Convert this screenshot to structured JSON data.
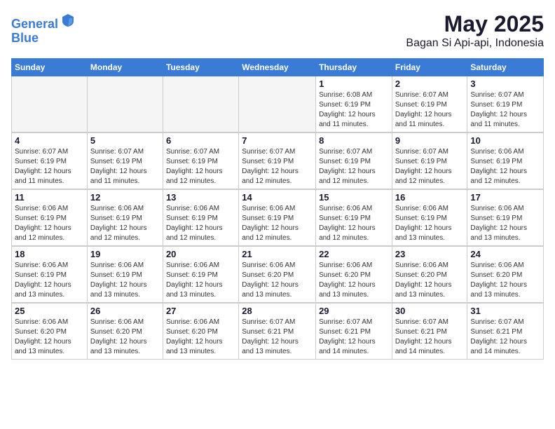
{
  "logo": {
    "line1": "General",
    "line2": "Blue"
  },
  "title": "May 2025",
  "location": "Bagan Si Api-api, Indonesia",
  "days_of_week": [
    "Sunday",
    "Monday",
    "Tuesday",
    "Wednesday",
    "Thursday",
    "Friday",
    "Saturday"
  ],
  "weeks": [
    [
      {
        "day": "",
        "info": "",
        "empty": true
      },
      {
        "day": "",
        "info": "",
        "empty": true
      },
      {
        "day": "",
        "info": "",
        "empty": true
      },
      {
        "day": "",
        "info": "",
        "empty": true
      },
      {
        "day": "1",
        "info": "Sunrise: 6:08 AM\nSunset: 6:19 PM\nDaylight: 12 hours\nand 11 minutes."
      },
      {
        "day": "2",
        "info": "Sunrise: 6:07 AM\nSunset: 6:19 PM\nDaylight: 12 hours\nand 11 minutes."
      },
      {
        "day": "3",
        "info": "Sunrise: 6:07 AM\nSunset: 6:19 PM\nDaylight: 12 hours\nand 11 minutes."
      }
    ],
    [
      {
        "day": "4",
        "info": "Sunrise: 6:07 AM\nSunset: 6:19 PM\nDaylight: 12 hours\nand 11 minutes."
      },
      {
        "day": "5",
        "info": "Sunrise: 6:07 AM\nSunset: 6:19 PM\nDaylight: 12 hours\nand 11 minutes."
      },
      {
        "day": "6",
        "info": "Sunrise: 6:07 AM\nSunset: 6:19 PM\nDaylight: 12 hours\nand 12 minutes."
      },
      {
        "day": "7",
        "info": "Sunrise: 6:07 AM\nSunset: 6:19 PM\nDaylight: 12 hours\nand 12 minutes."
      },
      {
        "day": "8",
        "info": "Sunrise: 6:07 AM\nSunset: 6:19 PM\nDaylight: 12 hours\nand 12 minutes."
      },
      {
        "day": "9",
        "info": "Sunrise: 6:07 AM\nSunset: 6:19 PM\nDaylight: 12 hours\nand 12 minutes."
      },
      {
        "day": "10",
        "info": "Sunrise: 6:06 AM\nSunset: 6:19 PM\nDaylight: 12 hours\nand 12 minutes."
      }
    ],
    [
      {
        "day": "11",
        "info": "Sunrise: 6:06 AM\nSunset: 6:19 PM\nDaylight: 12 hours\nand 12 minutes."
      },
      {
        "day": "12",
        "info": "Sunrise: 6:06 AM\nSunset: 6:19 PM\nDaylight: 12 hours\nand 12 minutes."
      },
      {
        "day": "13",
        "info": "Sunrise: 6:06 AM\nSunset: 6:19 PM\nDaylight: 12 hours\nand 12 minutes."
      },
      {
        "day": "14",
        "info": "Sunrise: 6:06 AM\nSunset: 6:19 PM\nDaylight: 12 hours\nand 12 minutes."
      },
      {
        "day": "15",
        "info": "Sunrise: 6:06 AM\nSunset: 6:19 PM\nDaylight: 12 hours\nand 12 minutes."
      },
      {
        "day": "16",
        "info": "Sunrise: 6:06 AM\nSunset: 6:19 PM\nDaylight: 12 hours\nand 13 minutes."
      },
      {
        "day": "17",
        "info": "Sunrise: 6:06 AM\nSunset: 6:19 PM\nDaylight: 12 hours\nand 13 minutes."
      }
    ],
    [
      {
        "day": "18",
        "info": "Sunrise: 6:06 AM\nSunset: 6:19 PM\nDaylight: 12 hours\nand 13 minutes."
      },
      {
        "day": "19",
        "info": "Sunrise: 6:06 AM\nSunset: 6:19 PM\nDaylight: 12 hours\nand 13 minutes."
      },
      {
        "day": "20",
        "info": "Sunrise: 6:06 AM\nSunset: 6:19 PM\nDaylight: 12 hours\nand 13 minutes."
      },
      {
        "day": "21",
        "info": "Sunrise: 6:06 AM\nSunset: 6:20 PM\nDaylight: 12 hours\nand 13 minutes."
      },
      {
        "day": "22",
        "info": "Sunrise: 6:06 AM\nSunset: 6:20 PM\nDaylight: 12 hours\nand 13 minutes."
      },
      {
        "day": "23",
        "info": "Sunrise: 6:06 AM\nSunset: 6:20 PM\nDaylight: 12 hours\nand 13 minutes."
      },
      {
        "day": "24",
        "info": "Sunrise: 6:06 AM\nSunset: 6:20 PM\nDaylight: 12 hours\nand 13 minutes."
      }
    ],
    [
      {
        "day": "25",
        "info": "Sunrise: 6:06 AM\nSunset: 6:20 PM\nDaylight: 12 hours\nand 13 minutes."
      },
      {
        "day": "26",
        "info": "Sunrise: 6:06 AM\nSunset: 6:20 PM\nDaylight: 12 hours\nand 13 minutes."
      },
      {
        "day": "27",
        "info": "Sunrise: 6:06 AM\nSunset: 6:20 PM\nDaylight: 12 hours\nand 13 minutes."
      },
      {
        "day": "28",
        "info": "Sunrise: 6:07 AM\nSunset: 6:21 PM\nDaylight: 12 hours\nand 13 minutes."
      },
      {
        "day": "29",
        "info": "Sunrise: 6:07 AM\nSunset: 6:21 PM\nDaylight: 12 hours\nand 14 minutes."
      },
      {
        "day": "30",
        "info": "Sunrise: 6:07 AM\nSunset: 6:21 PM\nDaylight: 12 hours\nand 14 minutes."
      },
      {
        "day": "31",
        "info": "Sunrise: 6:07 AM\nSunset: 6:21 PM\nDaylight: 12 hours\nand 14 minutes."
      }
    ]
  ]
}
